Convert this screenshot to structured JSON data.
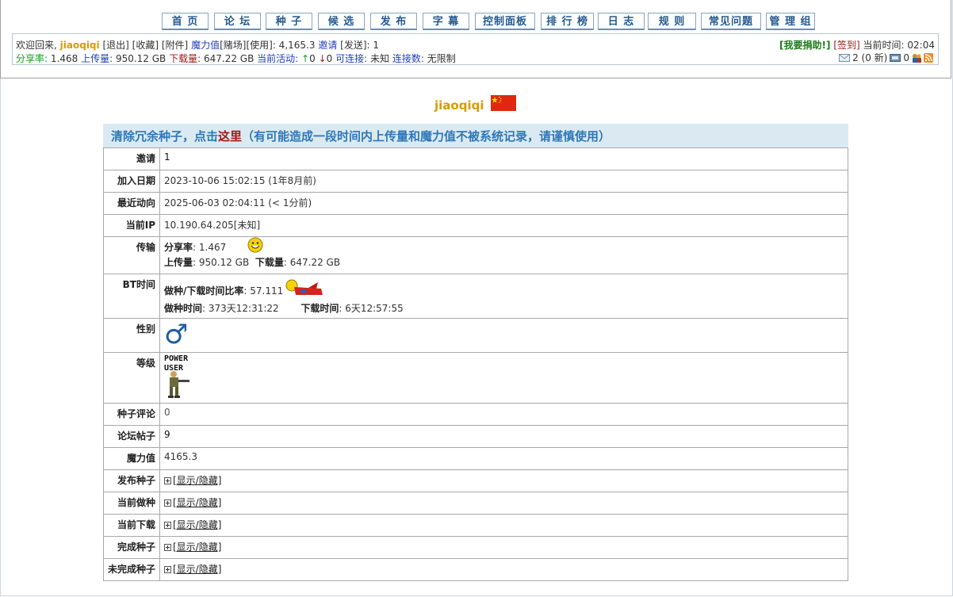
{
  "nav": [
    "首 页",
    "论 坛",
    "种 子",
    "候 选",
    "发 布",
    "字 幕",
    "控制面板",
    "排 行 榜",
    "日 志",
    "规 则",
    "常见问题",
    "管 理 组"
  ],
  "status": {
    "welcome": "欢迎回来,",
    "username": "jiaoqiqi",
    "logout": "[退出]",
    "bookmarks": "[收藏]",
    "attachments": "[附件]",
    "bonus_label": "魔力值",
    "bonus_rest": "[赌场][使用]: 4,165.3",
    "invite_label": "邀请",
    "invite_rest": "[发送]: 1",
    "ratio_label": "分享率:",
    "ratio_value": "1.468",
    "uploaded_label": "上传量:",
    "uploaded_value": "950.12 GB",
    "downloaded_label": "下载量:",
    "downloaded_value": "647.22 GB",
    "activity_label": "当前活动:",
    "seeding": "0",
    "leeching": "0",
    "connectable_label": "可连接:",
    "connectable_value": "未知",
    "connections_label": "连接数:",
    "connections_value": "无限制",
    "donate": "[我要捐助!]",
    "signin": "[签到]",
    "time_label": "当前时间:",
    "time_value": "02:04",
    "inbox": "2 (0 新)",
    "sent": "0"
  },
  "profile": {
    "name": "jiaoqiqi",
    "banner_prefix": "清除冗余种子，点击",
    "banner_link": "这里",
    "banner_suffix": "（有可能造成一段时间内上传量和魔力值不被系统记录，请谨慎使用）",
    "rows": {
      "invite_label": "邀请",
      "invite_value": "1",
      "joined_label": "加入日期",
      "joined_value": "2023-10-06 15:02:15 (1年8月前)",
      "last_label": "最近动向",
      "last_value": "2025-06-03 02:04:11 (< 1分前)",
      "ip_label": "当前IP",
      "ip_value": "10.190.64.205[未知]",
      "transfer_label": "传输",
      "ratio_label": "分享率",
      "ratio_value": ": 1.467",
      "up_label": "上传量",
      "up_value": ": 950.12 GB",
      "down_label": "下载量",
      "down_value": ": 647.22 GB",
      "bt_label": "BT时间",
      "seedratio_label": "做种/下载时间比率",
      "seedratio_value": ": 57.111",
      "seedtime_label": "做种时间",
      "seedtime_value": ": 373天12:31:22",
      "dltime_label": "下载时间",
      "dltime_value": ": 6天12:57:55",
      "gender_label": "性别",
      "gender_symbol": "♂",
      "class_label": "等级",
      "class_text": "POWER USER",
      "comments_label": "种子评论",
      "comments_value": "0",
      "posts_label": "论坛帖子",
      "posts_value": "9",
      "bonus_label": "魔力值",
      "bonus_value": "4165.3",
      "toggle_text": "[显示/隐藏]",
      "uploaded_t_label": "发布种子",
      "seeding_t_label": "当前做种",
      "leeching_t_label": "当前下载",
      "completed_t_label": "完成种子",
      "incomplete_t_label": "未完成种子"
    }
  },
  "colors": {
    "accent": "#26598c",
    "username": "#d89b00",
    "banner_bg": "#dbeaf2",
    "flag": "#de2910"
  },
  "icons": [
    "mail-icon",
    "sent-mail-icon",
    "friends-icon",
    "rss-icon",
    "smiley-icon",
    "superman-icon",
    "male-icon",
    "flag-icon",
    "class-badge-icon"
  ]
}
